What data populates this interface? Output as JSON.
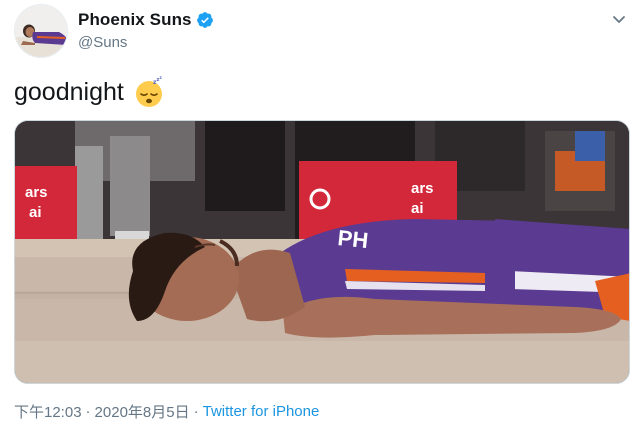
{
  "author": {
    "display_name": "Phoenix Suns",
    "handle": "@Suns",
    "verified": true,
    "avatar_icon": "avatar-image"
  },
  "tweet": {
    "text": "goodnight",
    "emoji": "sleeping-face-emoji"
  },
  "media": {
    "description_icon": "photo",
    "signage_left": [
      "ars",
      "ai"
    ],
    "signage_right": [
      "ars",
      "ai"
    ],
    "jersey_text": "PH"
  },
  "meta": {
    "time": "下午12:03",
    "separator": "·",
    "date": "2020年8月5日",
    "source": "Twitter for iPhone"
  },
  "colors": {
    "link": "#1b95e0",
    "verified_badge": "#1da1f2",
    "secondary_text": "#657786",
    "suns_purple": "#5b3b91",
    "suns_orange": "#e56020"
  }
}
